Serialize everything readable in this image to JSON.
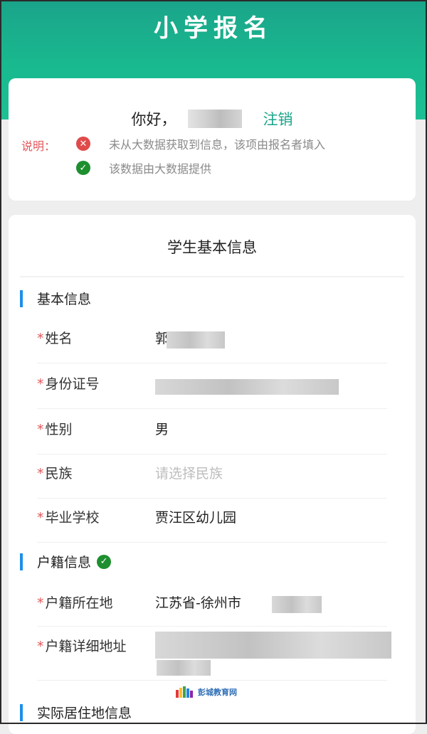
{
  "header": {
    "title": "小学报名"
  },
  "user": {
    "greeting": "你好，",
    "logout_label": "注销"
  },
  "legend": {
    "label": "说明：",
    "error_icon": "x-circle-icon",
    "error_text": "未从大数据获取到信息，该项由报名者填入",
    "ok_icon": "check-circle-icon",
    "ok_text": "该数据由大数据提供"
  },
  "form": {
    "title": "学生基本信息",
    "basic": {
      "header": "基本信息",
      "fields": [
        {
          "label": "姓名",
          "value": "郭"
        },
        {
          "label": "身份证号",
          "value": ""
        },
        {
          "label": "性别",
          "value": "男"
        },
        {
          "label": "民族",
          "placeholder": "请选择民族"
        },
        {
          "label": "毕业学校",
          "value": "贾汪区幼儿园"
        }
      ]
    },
    "household": {
      "header": "户籍信息",
      "status_icon": "check-circle-icon",
      "fields": [
        {
          "label": "户籍所在地",
          "value": "江苏省-徐州市"
        },
        {
          "label": "户籍详细地址",
          "value": ""
        }
      ]
    },
    "residence": {
      "header": "实际居住地信息"
    }
  },
  "watermark": {
    "text": "彭城教育网"
  },
  "colors": {
    "brand_green": "#19b98f",
    "link_green": "#18a48a",
    "required_red": "#e2585b",
    "section_bar_blue": "#1e8fe8",
    "ok_green": "#1e8f2f",
    "error_red": "#e04a4a"
  }
}
